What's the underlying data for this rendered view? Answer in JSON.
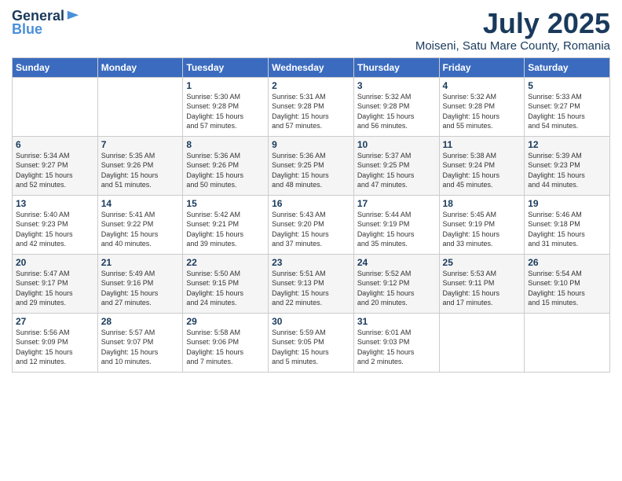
{
  "logo": {
    "general": "General",
    "blue": "Blue"
  },
  "header": {
    "title": "July 2025",
    "subtitle": "Moiseni, Satu Mare County, Romania"
  },
  "calendar": {
    "days_of_week": [
      "Sunday",
      "Monday",
      "Tuesday",
      "Wednesday",
      "Thursday",
      "Friday",
      "Saturday"
    ],
    "weeks": [
      [
        {
          "day": "",
          "info": ""
        },
        {
          "day": "",
          "info": ""
        },
        {
          "day": "1",
          "info": "Sunrise: 5:30 AM\nSunset: 9:28 PM\nDaylight: 15 hours\nand 57 minutes."
        },
        {
          "day": "2",
          "info": "Sunrise: 5:31 AM\nSunset: 9:28 PM\nDaylight: 15 hours\nand 57 minutes."
        },
        {
          "day": "3",
          "info": "Sunrise: 5:32 AM\nSunset: 9:28 PM\nDaylight: 15 hours\nand 56 minutes."
        },
        {
          "day": "4",
          "info": "Sunrise: 5:32 AM\nSunset: 9:28 PM\nDaylight: 15 hours\nand 55 minutes."
        },
        {
          "day": "5",
          "info": "Sunrise: 5:33 AM\nSunset: 9:27 PM\nDaylight: 15 hours\nand 54 minutes."
        }
      ],
      [
        {
          "day": "6",
          "info": "Sunrise: 5:34 AM\nSunset: 9:27 PM\nDaylight: 15 hours\nand 52 minutes."
        },
        {
          "day": "7",
          "info": "Sunrise: 5:35 AM\nSunset: 9:26 PM\nDaylight: 15 hours\nand 51 minutes."
        },
        {
          "day": "8",
          "info": "Sunrise: 5:36 AM\nSunset: 9:26 PM\nDaylight: 15 hours\nand 50 minutes."
        },
        {
          "day": "9",
          "info": "Sunrise: 5:36 AM\nSunset: 9:25 PM\nDaylight: 15 hours\nand 48 minutes."
        },
        {
          "day": "10",
          "info": "Sunrise: 5:37 AM\nSunset: 9:25 PM\nDaylight: 15 hours\nand 47 minutes."
        },
        {
          "day": "11",
          "info": "Sunrise: 5:38 AM\nSunset: 9:24 PM\nDaylight: 15 hours\nand 45 minutes."
        },
        {
          "day": "12",
          "info": "Sunrise: 5:39 AM\nSunset: 9:23 PM\nDaylight: 15 hours\nand 44 minutes."
        }
      ],
      [
        {
          "day": "13",
          "info": "Sunrise: 5:40 AM\nSunset: 9:23 PM\nDaylight: 15 hours\nand 42 minutes."
        },
        {
          "day": "14",
          "info": "Sunrise: 5:41 AM\nSunset: 9:22 PM\nDaylight: 15 hours\nand 40 minutes."
        },
        {
          "day": "15",
          "info": "Sunrise: 5:42 AM\nSunset: 9:21 PM\nDaylight: 15 hours\nand 39 minutes."
        },
        {
          "day": "16",
          "info": "Sunrise: 5:43 AM\nSunset: 9:20 PM\nDaylight: 15 hours\nand 37 minutes."
        },
        {
          "day": "17",
          "info": "Sunrise: 5:44 AM\nSunset: 9:19 PM\nDaylight: 15 hours\nand 35 minutes."
        },
        {
          "day": "18",
          "info": "Sunrise: 5:45 AM\nSunset: 9:19 PM\nDaylight: 15 hours\nand 33 minutes."
        },
        {
          "day": "19",
          "info": "Sunrise: 5:46 AM\nSunset: 9:18 PM\nDaylight: 15 hours\nand 31 minutes."
        }
      ],
      [
        {
          "day": "20",
          "info": "Sunrise: 5:47 AM\nSunset: 9:17 PM\nDaylight: 15 hours\nand 29 minutes."
        },
        {
          "day": "21",
          "info": "Sunrise: 5:49 AM\nSunset: 9:16 PM\nDaylight: 15 hours\nand 27 minutes."
        },
        {
          "day": "22",
          "info": "Sunrise: 5:50 AM\nSunset: 9:15 PM\nDaylight: 15 hours\nand 24 minutes."
        },
        {
          "day": "23",
          "info": "Sunrise: 5:51 AM\nSunset: 9:13 PM\nDaylight: 15 hours\nand 22 minutes."
        },
        {
          "day": "24",
          "info": "Sunrise: 5:52 AM\nSunset: 9:12 PM\nDaylight: 15 hours\nand 20 minutes."
        },
        {
          "day": "25",
          "info": "Sunrise: 5:53 AM\nSunset: 9:11 PM\nDaylight: 15 hours\nand 17 minutes."
        },
        {
          "day": "26",
          "info": "Sunrise: 5:54 AM\nSunset: 9:10 PM\nDaylight: 15 hours\nand 15 minutes."
        }
      ],
      [
        {
          "day": "27",
          "info": "Sunrise: 5:56 AM\nSunset: 9:09 PM\nDaylight: 15 hours\nand 12 minutes."
        },
        {
          "day": "28",
          "info": "Sunrise: 5:57 AM\nSunset: 9:07 PM\nDaylight: 15 hours\nand 10 minutes."
        },
        {
          "day": "29",
          "info": "Sunrise: 5:58 AM\nSunset: 9:06 PM\nDaylight: 15 hours\nand 7 minutes."
        },
        {
          "day": "30",
          "info": "Sunrise: 5:59 AM\nSunset: 9:05 PM\nDaylight: 15 hours\nand 5 minutes."
        },
        {
          "day": "31",
          "info": "Sunrise: 6:01 AM\nSunset: 9:03 PM\nDaylight: 15 hours\nand 2 minutes."
        },
        {
          "day": "",
          "info": ""
        },
        {
          "day": "",
          "info": ""
        }
      ]
    ]
  }
}
